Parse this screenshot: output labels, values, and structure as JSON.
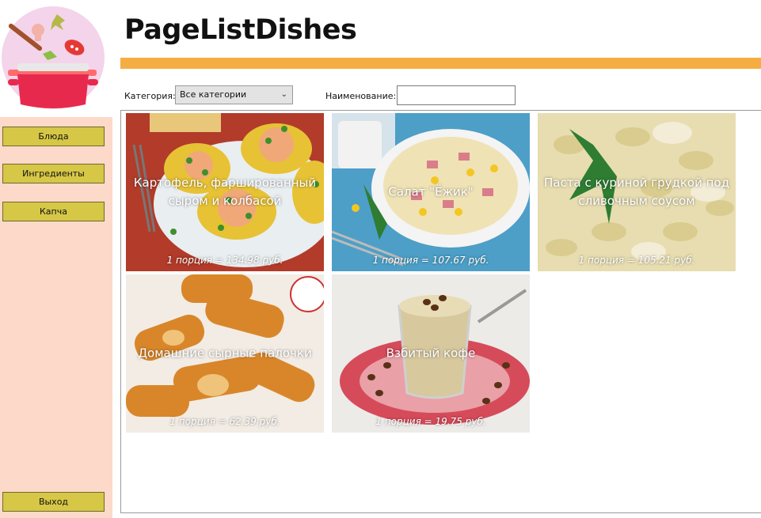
{
  "header": {
    "title": "PageListDishes"
  },
  "sidebar": {
    "logo": "cooking-pot-logo",
    "items": [
      {
        "label": "Блюда"
      },
      {
        "label": "Ингредиенты"
      },
      {
        "label": "Капча"
      }
    ],
    "exit_label": "Выход"
  },
  "filters": {
    "category_label": "Категория:",
    "category_value": "Все категории",
    "name_label": "Наименование:",
    "name_value": ""
  },
  "dishes": [
    {
      "name": "Картофель, фаршированный сыром и колбасой",
      "price": "1 порция = 134.98 руб."
    },
    {
      "name": "Салат \"Ёжик\"",
      "price": "1 порция = 107.67 руб."
    },
    {
      "name": "Паста с куриной грудкой под сливочным соусом",
      "price": "1 порция = 105.21 руб."
    },
    {
      "name": "Домашние сырные палочки",
      "price": "1 порция = 62.39 руб."
    },
    {
      "name": "Взбитый кофе",
      "price": "1 порция = 19.75 руб."
    }
  ],
  "colors": {
    "accent": "#f5ad42",
    "sidebar": "#fcd9c8",
    "button": "#d6c746"
  }
}
